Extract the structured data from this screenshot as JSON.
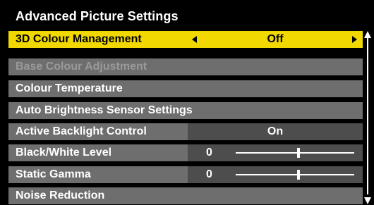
{
  "title": "Advanced Picture Settings",
  "colors": {
    "background": "#000000",
    "row": "#6e6e6e",
    "value_area": "#4d4d4d",
    "selected": "#f0d800",
    "disabled_text": "#9a9a9a"
  },
  "menu": {
    "items": [
      {
        "label": "3D Colour Management",
        "value": "Off",
        "state": "selected"
      },
      {
        "label": "Base Colour Adjustment",
        "state": "disabled"
      },
      {
        "label": "Colour Temperature"
      },
      {
        "label": "Auto Brightness Sensor Settings"
      },
      {
        "label": "Active Backlight Control",
        "value": "On"
      },
      {
        "label": "Black/White Level",
        "value": "0",
        "slider_fraction": 0.53
      },
      {
        "label": "Static Gamma",
        "value": "0",
        "slider_fraction": 0.53
      },
      {
        "label": "Noise Reduction"
      }
    ]
  },
  "icons": {
    "left": "left-arrow-icon",
    "right": "right-arrow-icon",
    "scroll_up": "scroll-up-arrow-icon",
    "scroll_down": "scroll-down-arrow-icon"
  }
}
